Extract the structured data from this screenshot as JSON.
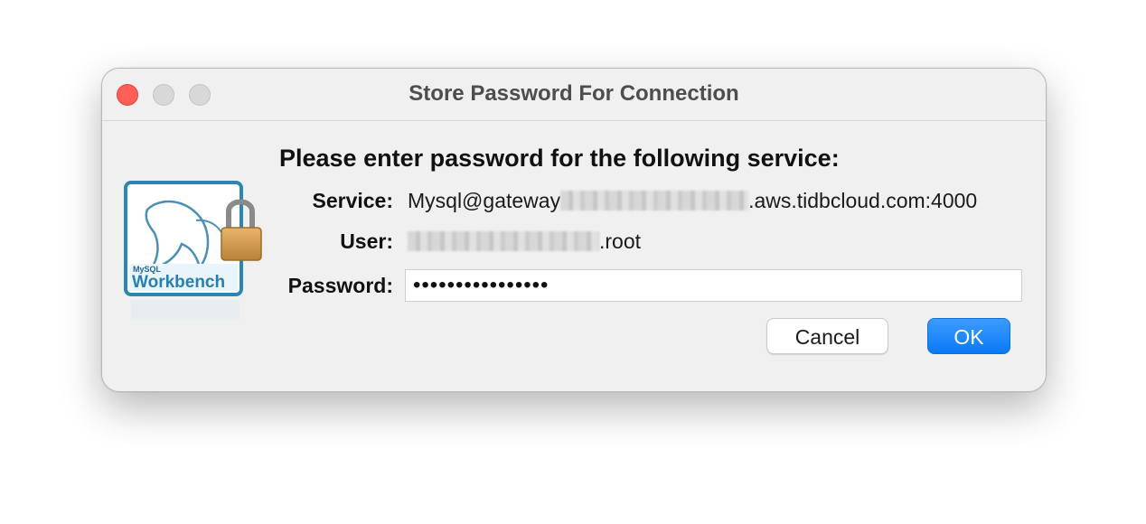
{
  "window": {
    "title": "Store Password For Connection"
  },
  "dialog": {
    "heading": "Please enter password for the following service:",
    "service_label": "Service:",
    "service_prefix": "Mysql@gateway",
    "service_suffix": ".aws.tidbcloud.com:4000",
    "user_label": "User:",
    "user_suffix": ".root",
    "password_label": "Password:",
    "password_value": "••••••••••••••••",
    "cancel_label": "Cancel",
    "ok_label": "OK"
  },
  "icon": {
    "name": "mysql-workbench-lock-icon",
    "brand_text": "Workbench",
    "brand_small": "MySQL"
  },
  "colors": {
    "ok_button": "#0a79f6",
    "close_button": "#ff5f57"
  }
}
